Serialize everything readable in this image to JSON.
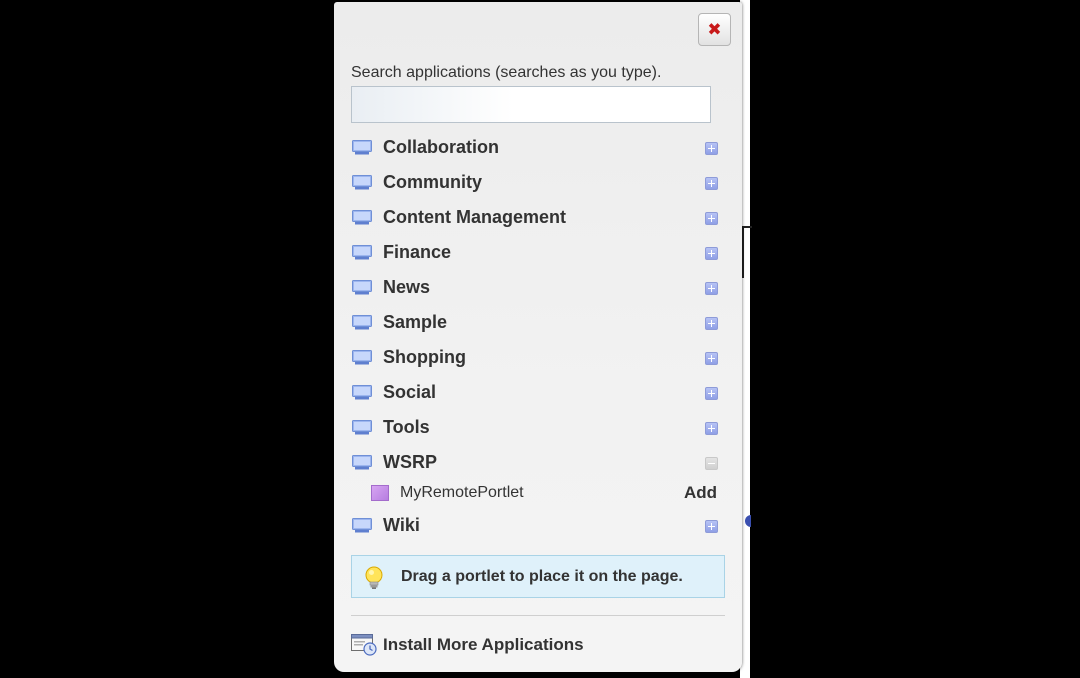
{
  "panel": {
    "close_label": "✖",
    "search": {
      "label": "Search applications (searches as you type).",
      "value": "",
      "placeholder": ""
    },
    "categories": [
      {
        "label": "Collaboration",
        "state": "collapsed"
      },
      {
        "label": "Community",
        "state": "collapsed"
      },
      {
        "label": "Content Management",
        "state": "collapsed"
      },
      {
        "label": "Finance",
        "state": "collapsed"
      },
      {
        "label": "News",
        "state": "collapsed"
      },
      {
        "label": "Sample",
        "state": "collapsed"
      },
      {
        "label": "Shopping",
        "state": "collapsed"
      },
      {
        "label": "Social",
        "state": "collapsed"
      },
      {
        "label": "Tools",
        "state": "collapsed"
      },
      {
        "label": "WSRP",
        "state": "expanded"
      },
      {
        "label": "Wiki",
        "state": "collapsed"
      }
    ],
    "wsrp_items": [
      {
        "label": "MyRemotePortlet",
        "action": "Add"
      }
    ],
    "tip": "Drag a portlet to place it on the page.",
    "install_label": "Install More Applications"
  },
  "colors": {
    "close_x": "#c8191a",
    "toggle_plus": "#9aa9ee",
    "tip_background": "#dff1fa",
    "portlet_icon": "#c48ee8"
  },
  "icons": {
    "close": "close-icon",
    "category": "monitor-icon",
    "expand": "plus-icon",
    "collapse": "minus-icon",
    "portlet": "portlet-icon",
    "tip": "lightbulb-icon",
    "install": "install-window-icon"
  }
}
